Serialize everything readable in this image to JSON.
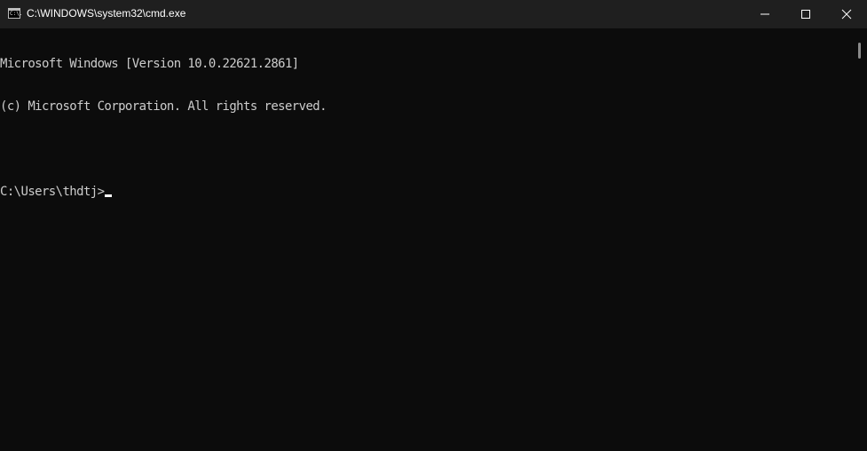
{
  "window": {
    "title": "C:\\WINDOWS\\system32\\cmd.exe",
    "icon": "cmd-icon",
    "icon_glyph": "C:\\."
  },
  "controls": {
    "minimize_icon": "minimize-icon",
    "maximize_icon": "maximize-icon",
    "close_icon": "close-icon"
  },
  "console": {
    "lines": [
      "Microsoft Windows [Version 10.0.22621.2861]",
      "(c) Microsoft Corporation. All rights reserved.",
      "",
      "C:\\Users\\thdtj>"
    ],
    "text_color": "#cccccc",
    "background": "#0c0c0c"
  },
  "colors": {
    "titlebar": "#1f1f1f",
    "title_text": "#ffffff",
    "cursor": "#ffffff"
  }
}
